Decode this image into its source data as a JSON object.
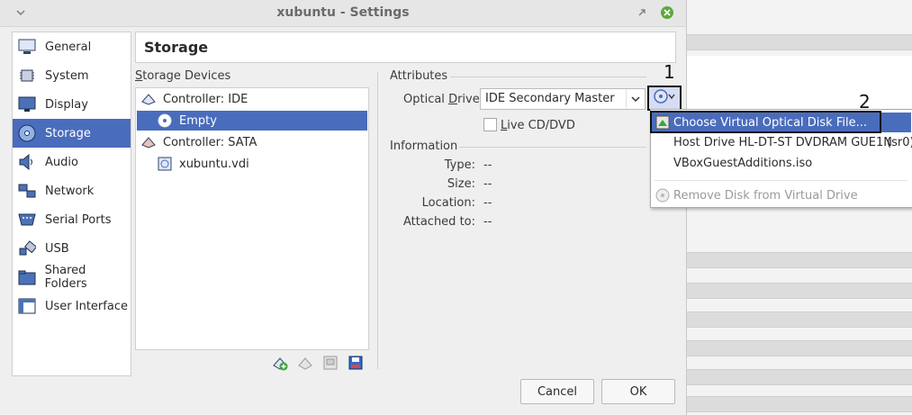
{
  "window": {
    "title": "xubuntu - Settings"
  },
  "categories": [
    {
      "label": "General",
      "icon": "general-icon"
    },
    {
      "label": "System",
      "icon": "chip-icon"
    },
    {
      "label": "Display",
      "icon": "monitor-icon"
    },
    {
      "label": "Storage",
      "icon": "disk-icon"
    },
    {
      "label": "Audio",
      "icon": "speaker-icon"
    },
    {
      "label": "Network",
      "icon": "network-icon"
    },
    {
      "label": "Serial Ports",
      "icon": "serial-port-icon"
    },
    {
      "label": "USB",
      "icon": "usb-icon"
    },
    {
      "label": "Shared Folders",
      "icon": "folder-icon"
    },
    {
      "label": "User Interface",
      "icon": "window-icon"
    }
  ],
  "selected_category": "Storage",
  "page_header": "Storage",
  "storage_devices": {
    "section_label": "Storage Devices",
    "section_label_mnemonic": "S",
    "section_label_rest": "torage Devices",
    "tree": [
      {
        "label": "Controller: IDE",
        "icon": "ide-controller-icon"
      },
      {
        "label": "Empty",
        "icon": "optical-disc-icon"
      },
      {
        "label": "Controller: SATA",
        "icon": "sata-controller-icon"
      },
      {
        "label": "xubuntu.vdi",
        "icon": "hard-disk-icon"
      }
    ]
  },
  "attributes": {
    "section_label": "Attributes",
    "optical_drive_label_pre": "Optical ",
    "optical_drive_label_mnemonic": "D",
    "optical_drive_label_post": "rive:",
    "optical_drive_value": "IDE Secondary Master",
    "live_label_mnemonic": "L",
    "live_label_rest": "ive CD/DVD"
  },
  "information": {
    "section_label": "Information",
    "rows": [
      {
        "label": "Type:",
        "value": "--"
      },
      {
        "label": "Size:",
        "value": "--"
      },
      {
        "label": "Location:",
        "value": "--"
      },
      {
        "label": "Attached to:",
        "value": "--"
      }
    ]
  },
  "menu": {
    "items": [
      {
        "label": "Choose Virtual Optical Disk File...",
        "icon": "choose-disk-icon"
      },
      {
        "label": "Host Drive HL-DT-ST DVDRAM GUE1N",
        "extra": "(sr0)"
      },
      {
        "label": "VBoxGuestAdditions.iso"
      },
      {
        "label": "Remove Disk from Virtual Drive",
        "icon": "remove-disk-icon"
      }
    ]
  },
  "buttons": {
    "cancel": "Cancel",
    "ok": "OK"
  },
  "callouts": {
    "one": "1",
    "two": "2"
  },
  "colors": {
    "selection": "#4a6cbc",
    "close_button": "#5aaa3c"
  }
}
